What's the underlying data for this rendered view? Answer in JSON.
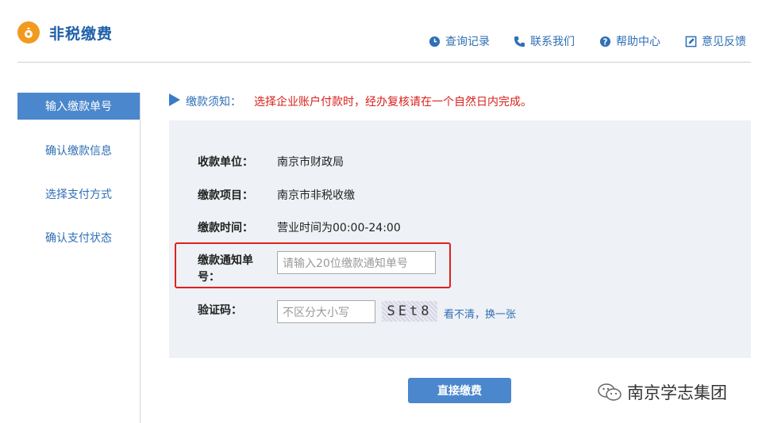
{
  "header": {
    "title": "非税缴费",
    "nav": [
      {
        "label": "查询记录",
        "icon": "clock-icon"
      },
      {
        "label": "联系我们",
        "icon": "phone-icon"
      },
      {
        "label": "帮助中心",
        "icon": "help-icon"
      },
      {
        "label": "意见反馈",
        "icon": "edit-icon"
      }
    ]
  },
  "sidebar": {
    "items": [
      {
        "label": "输入缴款单号",
        "active": true
      },
      {
        "label": "确认缴款信息"
      },
      {
        "label": "选择支付方式"
      },
      {
        "label": "确认支付状态"
      }
    ]
  },
  "notice": {
    "label": "缴款须知：",
    "text": "选择企业账户付款时，经办复核请在一个自然日内完成。"
  },
  "form": {
    "payee_label": "收款单位：",
    "payee_value": "南京市财政局",
    "item_label": "缴款项目：",
    "item_value": "南京市非税收缴",
    "time_label": "缴款时间：",
    "time_value": "营业时间为00:00-24:00",
    "notice_no_label_1": "缴款通知单",
    "notice_no_label_2": "号：",
    "notice_no_placeholder": "请输入20位缴款通知单号",
    "captcha_label": "验证码：",
    "captcha_placeholder": "不区分大小写",
    "captcha_text": "SEt8",
    "refresh_label": "看不清，换一张"
  },
  "submit_label": "直接缴费",
  "watermark": "南京学志集团",
  "colors": {
    "accent": "#4b87cc",
    "link": "#2f6fb5",
    "warning": "#d9201c",
    "logo": "#f29a1f",
    "highlight": "#e02020"
  }
}
